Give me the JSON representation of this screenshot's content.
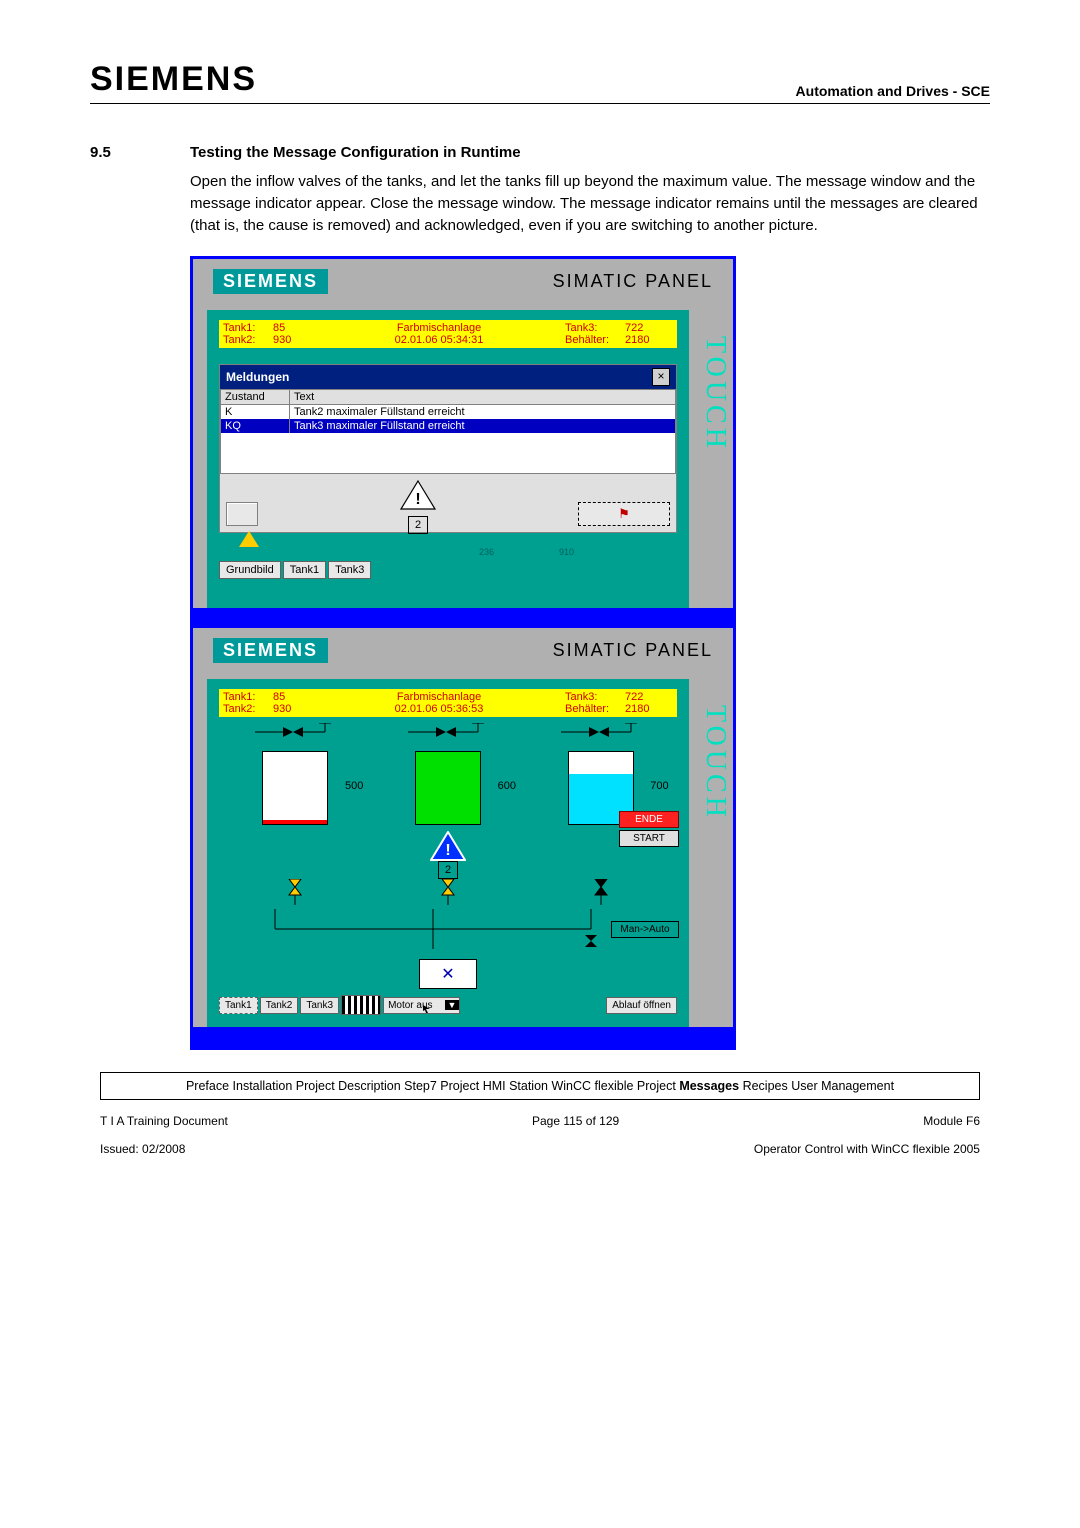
{
  "header": {
    "logo": "SIEMENS",
    "right": "Automation and Drives - SCE"
  },
  "section": {
    "number": "9.5",
    "title": "Testing the Message Configuration in Runtime",
    "body": "Open the inflow valves of the tanks, and let the tanks fill up beyond the maximum value. The message window and the message indicator appear.  Close the message window. The message indicator remains until the messages are cleared (that is, the cause is removed) and acknowledged, even if you are switching to another picture."
  },
  "panel_common": {
    "siemens": "SIEMENS",
    "brand": "SIMATIC PANEL",
    "touch": "TOUCH"
  },
  "panel1": {
    "status": {
      "tank1_lbl": "Tank1:",
      "tank1_val": "85",
      "tank2_lbl": "Tank2:",
      "tank2_val": "930",
      "title": "Farbmischanlage",
      "timestamp": "02.01.06 05:34:31",
      "tank3_lbl": "Tank3:",
      "tank3_val": "722",
      "beh_lbl": "Behälter:",
      "beh_val": "2180"
    },
    "msg": {
      "title": "Meldungen",
      "close": "×",
      "col_state": "Zustand",
      "col_text": "Text",
      "rows": [
        {
          "state": "K",
          "text": "Tank2 maximaler Füllstand erreicht"
        },
        {
          "state": "KQ",
          "text": "Tank3 maximaler Füllstand erreicht"
        }
      ],
      "indicator_count": "2"
    },
    "overlap": {
      "a": "236",
      "b": "910"
    },
    "tabs": [
      "Grundbild",
      "Tank1",
      "Tank3"
    ]
  },
  "panel2": {
    "status": {
      "tank1_lbl": "Tank1:",
      "tank1_val": "85",
      "tank2_lbl": "Tank2:",
      "tank2_val": "930",
      "title": "Farbmischanlage",
      "timestamp": "02.01.06 05:36:53",
      "tank3_lbl": "Tank3:",
      "tank3_val": "722",
      "beh_lbl": "Behälter:",
      "beh_val": "2180"
    },
    "tanks": [
      {
        "label": "500",
        "color": "#ff0000",
        "fill_pct": 6
      },
      {
        "label": "600",
        "color": "#00e000",
        "fill_pct": 100
      },
      {
        "label": "700",
        "color": "#00e0ff",
        "fill_pct": 70
      }
    ],
    "indicator_count": "2",
    "side": {
      "ende": "ENDE",
      "start": "START",
      "mode": "Man->Auto"
    },
    "bottom": {
      "tabs": [
        "Tank1",
        "Tank2",
        "Tank3"
      ],
      "dropdown": "Motor aus",
      "ablauf": "Ablauf öffnen"
    }
  },
  "breadcrumb": {
    "items": [
      "Preface",
      "Installation",
      "Project Description",
      "Step7 Project",
      "HMI Station",
      "WinCC flexible Project"
    ],
    "active": "Messages",
    "items_after": [
      "Recipes",
      "User Management"
    ]
  },
  "footer": {
    "l1_left": "T I A  Training Document",
    "l1_center": "Page 115 of 129",
    "l1_right": "Module F6",
    "l2_left": "Issued: 02/2008",
    "l2_right": "Operator Control with WinCC flexible 2005"
  }
}
